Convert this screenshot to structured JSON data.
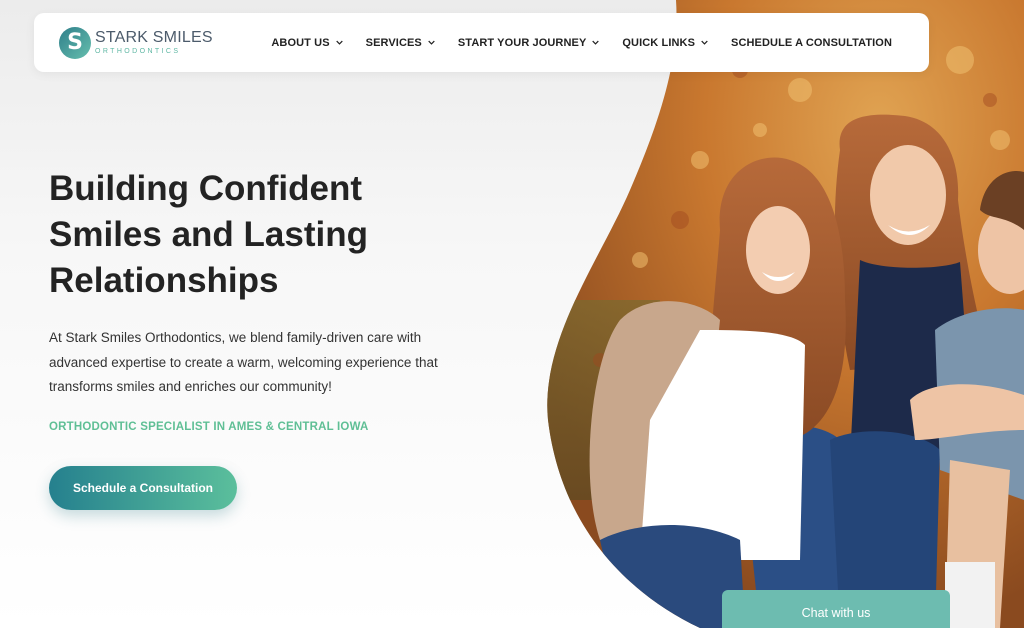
{
  "brand": {
    "logo_letter": "S",
    "title": "STARK SMILES",
    "subtitle": "ORTHODONTICS"
  },
  "nav": {
    "items": [
      {
        "label": "ABOUT US",
        "has_dropdown": true
      },
      {
        "label": "SERVICES",
        "has_dropdown": true
      },
      {
        "label": "START YOUR JOURNEY",
        "has_dropdown": true
      },
      {
        "label": "QUICK LINKS",
        "has_dropdown": true
      },
      {
        "label": "SCHEDULE A CONSULTATION",
        "has_dropdown": false
      }
    ]
  },
  "hero": {
    "headline_line1": "Building Confident",
    "headline_line2": "Smiles and Lasting",
    "headline_line3": "Relationships",
    "intro": "At Stark Smiles Orthodontics, we blend family-driven care with advanced expertise to create a warm, welcoming experience that transforms smiles and enriches our community!",
    "tagline": "ORTHODONTIC SPECIALIST IN AMES & CENTRAL IOWA",
    "cta_label": "Schedule a Consultation"
  },
  "chat": {
    "label": "Chat with us"
  },
  "colors": {
    "accent_teal": "#25808e",
    "accent_green": "#5bbf9c",
    "chat_bg": "#6dbcb0",
    "text_dark": "#232323"
  }
}
